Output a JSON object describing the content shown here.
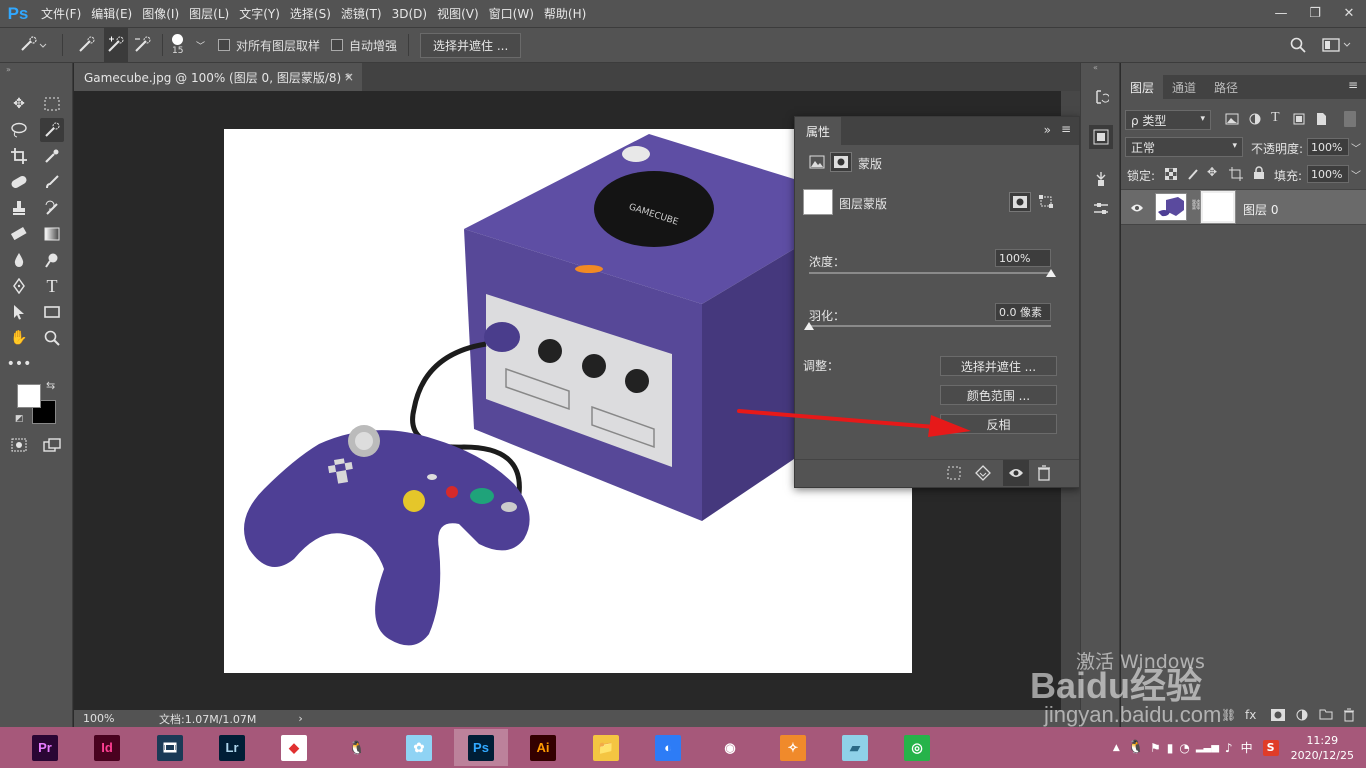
{
  "app": {
    "logo": "Ps"
  },
  "menu": [
    "文件(F)",
    "编辑(E)",
    "图像(I)",
    "图层(L)",
    "文字(Y)",
    "选择(S)",
    "滤镜(T)",
    "3D(D)",
    "视图(V)",
    "窗口(W)",
    "帮助(H)"
  ],
  "window_controls": {
    "minimize": "—",
    "restore": "❐",
    "close": "✕"
  },
  "options": {
    "brush_size": "15",
    "sample_all_layers": "对所有图层取样",
    "auto_enhance": "自动增强",
    "select_and_mask": "选择并遮住 ..."
  },
  "document": {
    "tab_title": "Gamecube.jpg @ 100% (图层 0, 图层蒙版/8) *",
    "tab_close": "×",
    "zoom": "100%",
    "doc_info": "文档:1.07M/1.07M",
    "status_arrow": "›"
  },
  "properties": {
    "title": "属性",
    "collapse": "»",
    "menu": "≡",
    "mask_section": "蒙版",
    "layer_mask_label": "图层蒙版",
    "density_label": "浓度：",
    "density_value": "100%",
    "density_level": 1.0,
    "feather_label": "羽化：",
    "feather_value": "0.0 像素",
    "feather_level": 0.0,
    "adjust_label": "调整：",
    "select_and_mask_btn": "选择并遮住 ...",
    "color_range_btn": "颜色范围 ...",
    "invert_btn": "反相"
  },
  "layers_panel": {
    "tabs": [
      "图层",
      "通道",
      "路径"
    ],
    "kind_filter": "ρ 类型",
    "blend_mode": "正常",
    "opacity_label": "不透明度:",
    "opacity_value": "100%",
    "lock_label": "锁定:",
    "fill_label": "填充:",
    "fill_value": "100%",
    "layers": [
      {
        "name": "图层 0",
        "visible": true
      }
    ]
  },
  "taskbar": {
    "apps": [
      {
        "name": "Pr",
        "bg": "#2a0634",
        "fg": "#e77cff"
      },
      {
        "name": "Id",
        "bg": "#49021f",
        "fg": "#ff3f93"
      },
      {
        "name": "🎞",
        "bg": "#1a3a56",
        "fg": "#ffffff"
      },
      {
        "name": "Lr",
        "bg": "#001e36",
        "fg": "#add5ec"
      },
      {
        "name": "◆",
        "bg": "#ffffff",
        "fg": "#e03030"
      },
      {
        "name": "🐧",
        "bg": "transparent",
        "fg": "#000000"
      },
      {
        "name": "✿",
        "bg": "#8fd3f4",
        "fg": "#ffffff"
      },
      {
        "name": "Ps",
        "bg": "#001e36",
        "fg": "#31a8ff"
      },
      {
        "name": "Ai",
        "bg": "#330000",
        "fg": "#ff9a00"
      },
      {
        "name": "📁",
        "bg": "#f4c542",
        "fg": "#6b4a00"
      },
      {
        "name": "◐",
        "bg": "#2d7cf6",
        "fg": "#ffffff"
      },
      {
        "name": "◉",
        "bg": "transparent",
        "fg": "#ffffff"
      },
      {
        "name": "✧",
        "bg": "#f08a2b",
        "fg": "#ffffff"
      },
      {
        "name": "▰",
        "bg": "#8fd1e8",
        "fg": "#2a6a86"
      },
      {
        "name": "◎",
        "bg": "#26b34a",
        "fg": "#ffffff"
      }
    ],
    "active_index": 7,
    "time": "11:29",
    "date": "2020/12/25",
    "ime": "中",
    "tray_icons": [
      "▲",
      "🐧",
      "⚑",
      "▮",
      "◔",
      "▂▃▅",
      "♪"
    ]
  },
  "watermarks": {
    "activate": "激活 Windows",
    "baidu": "Baidu经验",
    "url": "jingyan.baidu.com"
  },
  "colors": {
    "ps_blue": "#31a8ff",
    "arrow_red": "#e61919",
    "gamecube_purple": "#5a4a9e"
  }
}
